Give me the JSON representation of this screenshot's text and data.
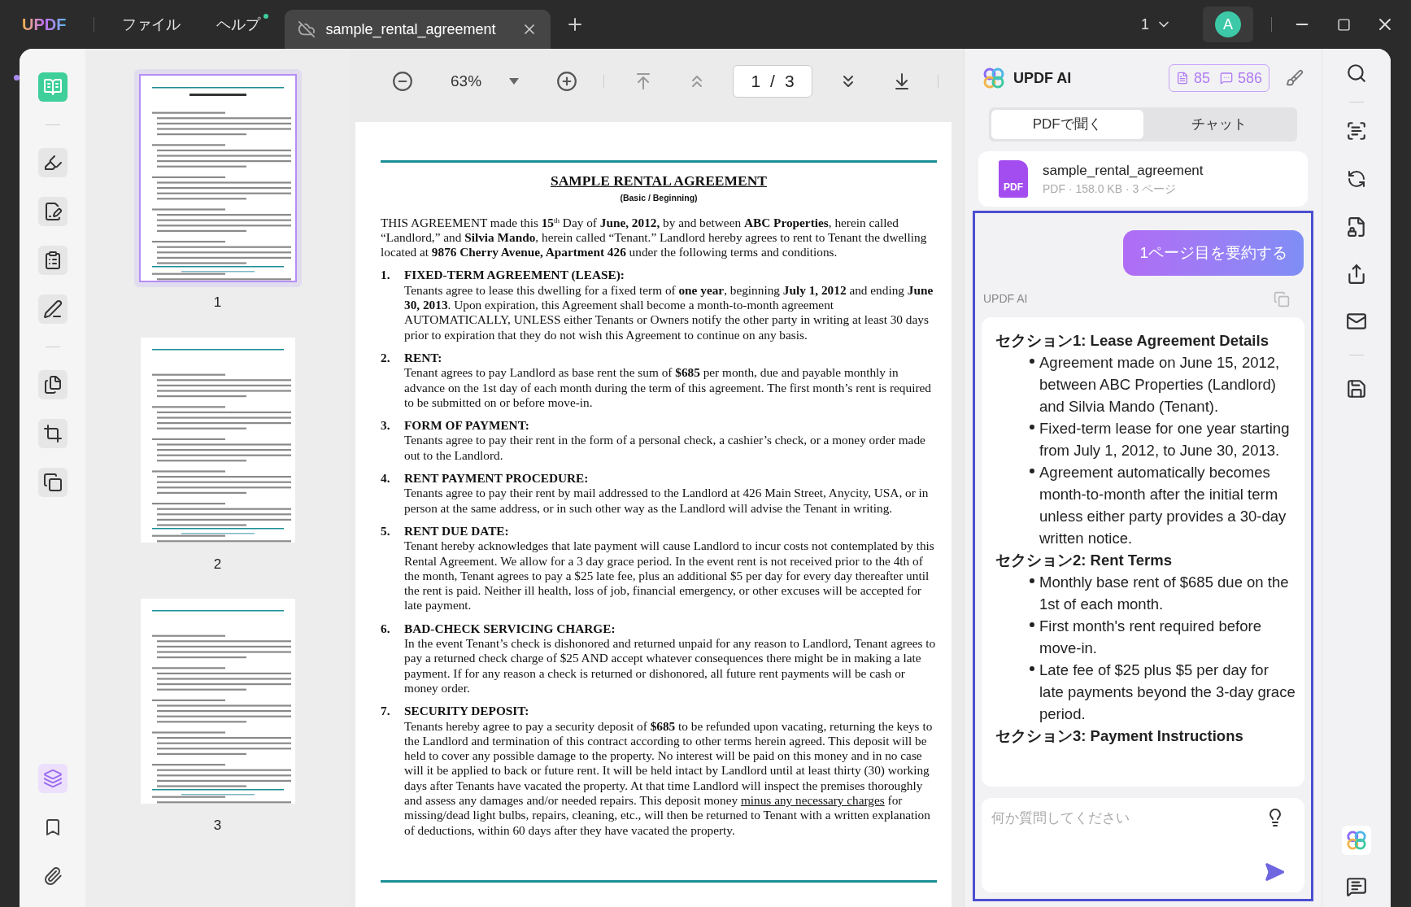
{
  "app": {
    "logo": "UPDF",
    "menu": [
      {
        "label": "ファイル",
        "badge": false
      },
      {
        "label": "ヘルプ",
        "badge": true
      }
    ],
    "tabs": [
      {
        "title": "sample_rental_agreement",
        "selected": true
      }
    ],
    "window_count": "1",
    "avatar": "A"
  },
  "left_toolbar": {
    "tools": [
      {
        "kind": "reader",
        "selected": true
      },
      {
        "kind": "comment",
        "selected": false
      },
      {
        "kind": "edit",
        "selected": false
      },
      {
        "kind": "form",
        "selected": false
      },
      {
        "kind": "sign",
        "selected": false
      },
      {
        "kind": "organize",
        "selected": false
      },
      {
        "kind": "crop",
        "selected": false
      },
      {
        "kind": "tools",
        "selected": false
      }
    ],
    "panels": [
      {
        "kind": "thumbnails",
        "selected": true
      },
      {
        "kind": "bookmarks",
        "selected": false
      },
      {
        "kind": "attachments",
        "selected": false
      }
    ]
  },
  "thumbnails": [
    {
      "label": "1",
      "selected": true
    },
    {
      "label": "2",
      "selected": false
    },
    {
      "label": "3",
      "selected": false
    }
  ],
  "viewer_toolbar": {
    "zoom": "63%",
    "current_page": "1",
    "separator": "/",
    "total_pages": "3"
  },
  "document": {
    "title": "SAMPLE RENTAL AGREEMENT",
    "subtitle": "(Basic / Beginning)",
    "intro": "THIS AGREEMENT made this **15**$^{th}$ Day of **June, 2012,** by and between **ABC Properties**, herein called “Landlord,” and **Silvia Mando**, herein called “Tenant.” Landlord hereby agrees to rent to Tenant the dwelling located at **9876 Cherry Avenue, Apartment 426** under the following terms and conditions.",
    "sections": [
      {
        "number": "1.",
        "heading": "FIXED-TERM AGREEMENT (LEASE):",
        "body": [
          {
            "text": "Tenants agree to lease this dwelling for a fixed term of **one year**, beginning **July 1, 2012** and ending **June 30, 2013**. Upon expiration, this Agreement shall become a month-to-month agreement AUTOMATICALLY, UNLESS either Tenants or Owners notify the other party in writing at least 30 days prior to expiration that they do not wish this Agreement to continue on any basis.",
            "underline": false
          }
        ]
      },
      {
        "number": "2.",
        "heading": "RENT:",
        "body": [
          {
            "text": "Tenant agrees to pay Landlord as base rent the sum of **$685** per month, due and payable monthly in advance on the 1st day of each month during the term of this agreement. The first month’s rent is required to be submitted on or before move-in.",
            "underline": false
          }
        ]
      },
      {
        "number": "3.",
        "heading": "FORM OF PAYMENT:",
        "body": [
          {
            "text": "Tenants agree to pay their rent in the form of a personal check, a cashier’s check, or a money order made out to the Landlord.",
            "underline": false
          }
        ]
      },
      {
        "number": "4.",
        "heading": "RENT PAYMENT PROCEDURE:",
        "body": [
          {
            "text": "Tenants agree to pay their rent by mail addressed to the Landlord at 426 Main Street, Anycity, USA, or in person at the same address, or in such other way as the Landlord will advise the Tenant in writing.",
            "underline": false
          }
        ]
      },
      {
        "number": "5.",
        "heading": "RENT DUE DATE:",
        "body": [
          {
            "text": "Tenant hereby acknowledges that late payment will cause Landlord to incur costs not contemplated by this Rental Agreement. We allow for a 3 day grace period. In the event rent is not received prior to the 4th of the month, Tenant agrees to pay a $25 late fee, plus an additional $5 per day for every day thereafter until the rent is paid. Neither ill health, loss of job, financial emergency, or other excuses will be accepted for late payment.",
            "underline": false
          }
        ]
      },
      {
        "number": "6.",
        "heading": "BAD-CHECK SERVICING CHARGE:",
        "body": [
          {
            "text": "In the event Tenant’s check is dishonored and returned unpaid for any reason to Landlord, Tenant agrees to pay a returned check charge of $25 AND accept whatever consequences there might be in making a late payment. If for any reason a check is returned or dishonored, all future rent payments will be cash or money order.",
            "underline": false
          }
        ]
      },
      {
        "number": "7.",
        "heading": "SECURITY DEPOSIT:",
        "body": [
          {
            "text": "Tenants hereby agree to pay a security deposit of **$685** to be refunded upon vacating, returning the keys to the Landlord and termination of this contract according to other terms herein agreed. This deposit will be held to cover any possible damage to the property. No interest will be paid on this money and in no case will it be applied to back or future rent. It will be held intact by Landlord until at least thirty (30) working days after Tenants have vacated the property. At that time Landlord will inspect the premises thoroughly and assess any damages and/or needed repairs. This deposit money ",
            "underline": false
          },
          {
            "text": "minus any necessary charges",
            "underline": true
          },
          {
            "text": " for missing/dead light bulbs, repairs, cleaning, etc., will then be returned to Tenant with a written explanation of deductions, within 60 days after they have vacated the property.",
            "underline": false
          }
        ]
      }
    ]
  },
  "ai_panel": {
    "title": "UPDF AI",
    "document_credits": "85",
    "chat_credits": "586",
    "tabs": [
      {
        "label": "PDFで聞く",
        "selected": true
      },
      {
        "label": "チャット",
        "selected": false
      }
    ],
    "file": {
      "icon_label": "PDF",
      "name": "sample_rental_agreement",
      "meta": "PDF · 158.0 KB · 3 ページ"
    },
    "user_message": "1ページ目を要約する",
    "responder": "UPDF AI",
    "answer": [
      {
        "heading": "セクション1: Lease Agreement Details",
        "bullets": [
          "Agreement made on June 15, 2012, between ABC Properties (Landlord) and Silvia Mando (Tenant).",
          "Fixed-term lease for one year starting from July 1, 2012, to June 30, 2013.",
          "Agreement automatically becomes month-to-month after the initial term unless either party provides a 30-day written notice."
        ]
      },
      {
        "heading": "セクション2: Rent Terms",
        "bullets": [
          "Monthly base rent of $685 due on the 1st of each month.",
          "First month's rent required before move-in.",
          "Late fee of $25 plus $5 per day for late payments beyond the 3-day grace period."
        ]
      },
      {
        "heading": "セクション3: Payment Instructions"
      }
    ],
    "input": {
      "placeholder": "何か質問してください"
    }
  }
}
